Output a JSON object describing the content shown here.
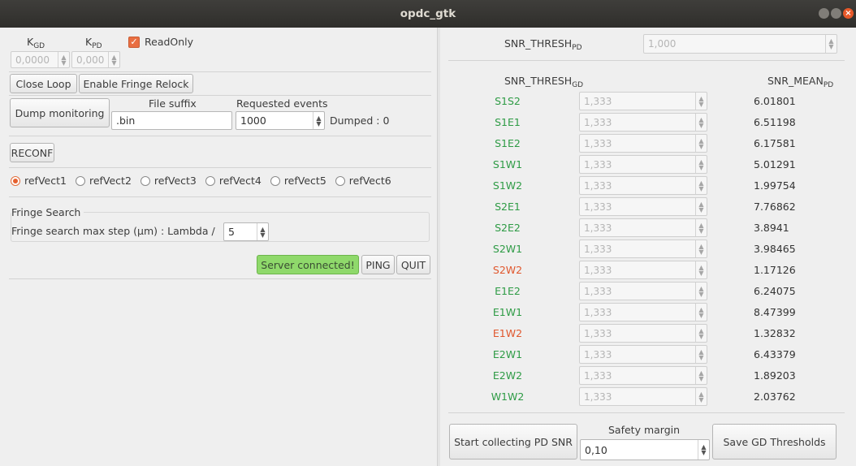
{
  "window": {
    "title": "opdc_gtk"
  },
  "gains": {
    "kgd_label": "K",
    "kgd_sub": "GD",
    "kpd_label": "K",
    "kpd_sub": "PD",
    "kgd_value": "0,0000",
    "kpd_value": "0,000",
    "readonly_label": "ReadOnly",
    "readonly_checked": true
  },
  "loop": {
    "close_loop": "Close Loop",
    "enable_relock": "Enable Fringe Relock"
  },
  "dump": {
    "button": "Dump monitoring",
    "file_suffix_label": "File suffix",
    "file_suffix_value": ".bin",
    "requested_label": "Requested events",
    "requested_value": "1000",
    "dumped_text": "Dumped : 0"
  },
  "reconf": "RECONF",
  "ref_vectors": {
    "selected": "refVect1",
    "items": [
      "refVect1",
      "refVect2",
      "refVect3",
      "refVect4",
      "refVect5",
      "refVect6"
    ]
  },
  "fringe_search": {
    "title": "Fringe Search",
    "label": "Fringe search max step (µm) : Lambda /",
    "value": "5"
  },
  "status": {
    "server": "Server connected!",
    "ping": "PING",
    "quit": "QUIT"
  },
  "snr": {
    "thresh_pd_label": "SNR_THRESH",
    "thresh_pd_sub": "PD",
    "thresh_pd_value": "1,000",
    "thresh_gd_label": "SNR_THRESH",
    "thresh_gd_sub": "GD",
    "mean_pd_label": "SNR_MEAN",
    "mean_pd_sub": "PD",
    "rows": [
      {
        "name": "S1S2",
        "thresh": "1,333",
        "mean": "6.01801",
        "status": "ok"
      },
      {
        "name": "S1E1",
        "thresh": "1,333",
        "mean": "6.51198",
        "status": "ok"
      },
      {
        "name": "S1E2",
        "thresh": "1,333",
        "mean": "6.17581",
        "status": "ok"
      },
      {
        "name": "S1W1",
        "thresh": "1,333",
        "mean": "5.01291",
        "status": "ok"
      },
      {
        "name": "S1W2",
        "thresh": "1,333",
        "mean": "1.99754",
        "status": "ok"
      },
      {
        "name": "S2E1",
        "thresh": "1,333",
        "mean": "7.76862",
        "status": "ok"
      },
      {
        "name": "S2E2",
        "thresh": "1,333",
        "mean": "3.8941",
        "status": "ok"
      },
      {
        "name": "S2W1",
        "thresh": "1,333",
        "mean": "3.98465",
        "status": "ok"
      },
      {
        "name": "S2W2",
        "thresh": "1,333",
        "mean": "1.17126",
        "status": "low"
      },
      {
        "name": "E1E2",
        "thresh": "1,333",
        "mean": "6.24075",
        "status": "ok"
      },
      {
        "name": "E1W1",
        "thresh": "1,333",
        "mean": "8.47399",
        "status": "ok"
      },
      {
        "name": "E1W2",
        "thresh": "1,333",
        "mean": "1.32832",
        "status": "low"
      },
      {
        "name": "E2W1",
        "thresh": "1,333",
        "mean": "6.43379",
        "status": "ok"
      },
      {
        "name": "E2W2",
        "thresh": "1,333",
        "mean": "1.89203",
        "status": "ok"
      },
      {
        "name": "W1W2",
        "thresh": "1,333",
        "mean": "2.03762",
        "status": "ok"
      }
    ]
  },
  "bottom": {
    "start_collecting": "Start collecting PD SNR",
    "safety_margin_label": "Safety margin",
    "safety_margin_value": "0,10",
    "save_thresholds": "Save GD Thresholds"
  },
  "colors": {
    "ok": "#2e9b45",
    "low": "#e0572d",
    "accent": "#e96e41",
    "server_bg": "#8fd96b"
  }
}
